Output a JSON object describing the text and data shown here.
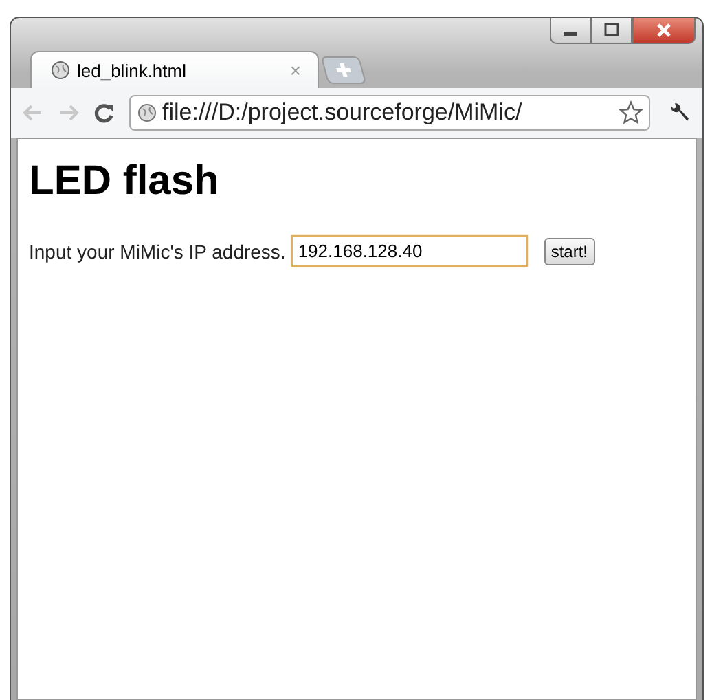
{
  "tabs": [
    {
      "title": "led_blink.html",
      "close": "×",
      "selected": true
    }
  ],
  "address_bar": {
    "url": "file:///D:/project.sourceforge/MiMic/"
  },
  "page": {
    "heading": "LED flash",
    "label": "Input your MiMic's IP address.",
    "ip_field": {
      "value": "192.168.128.40",
      "focused": true
    },
    "button": "start!"
  }
}
